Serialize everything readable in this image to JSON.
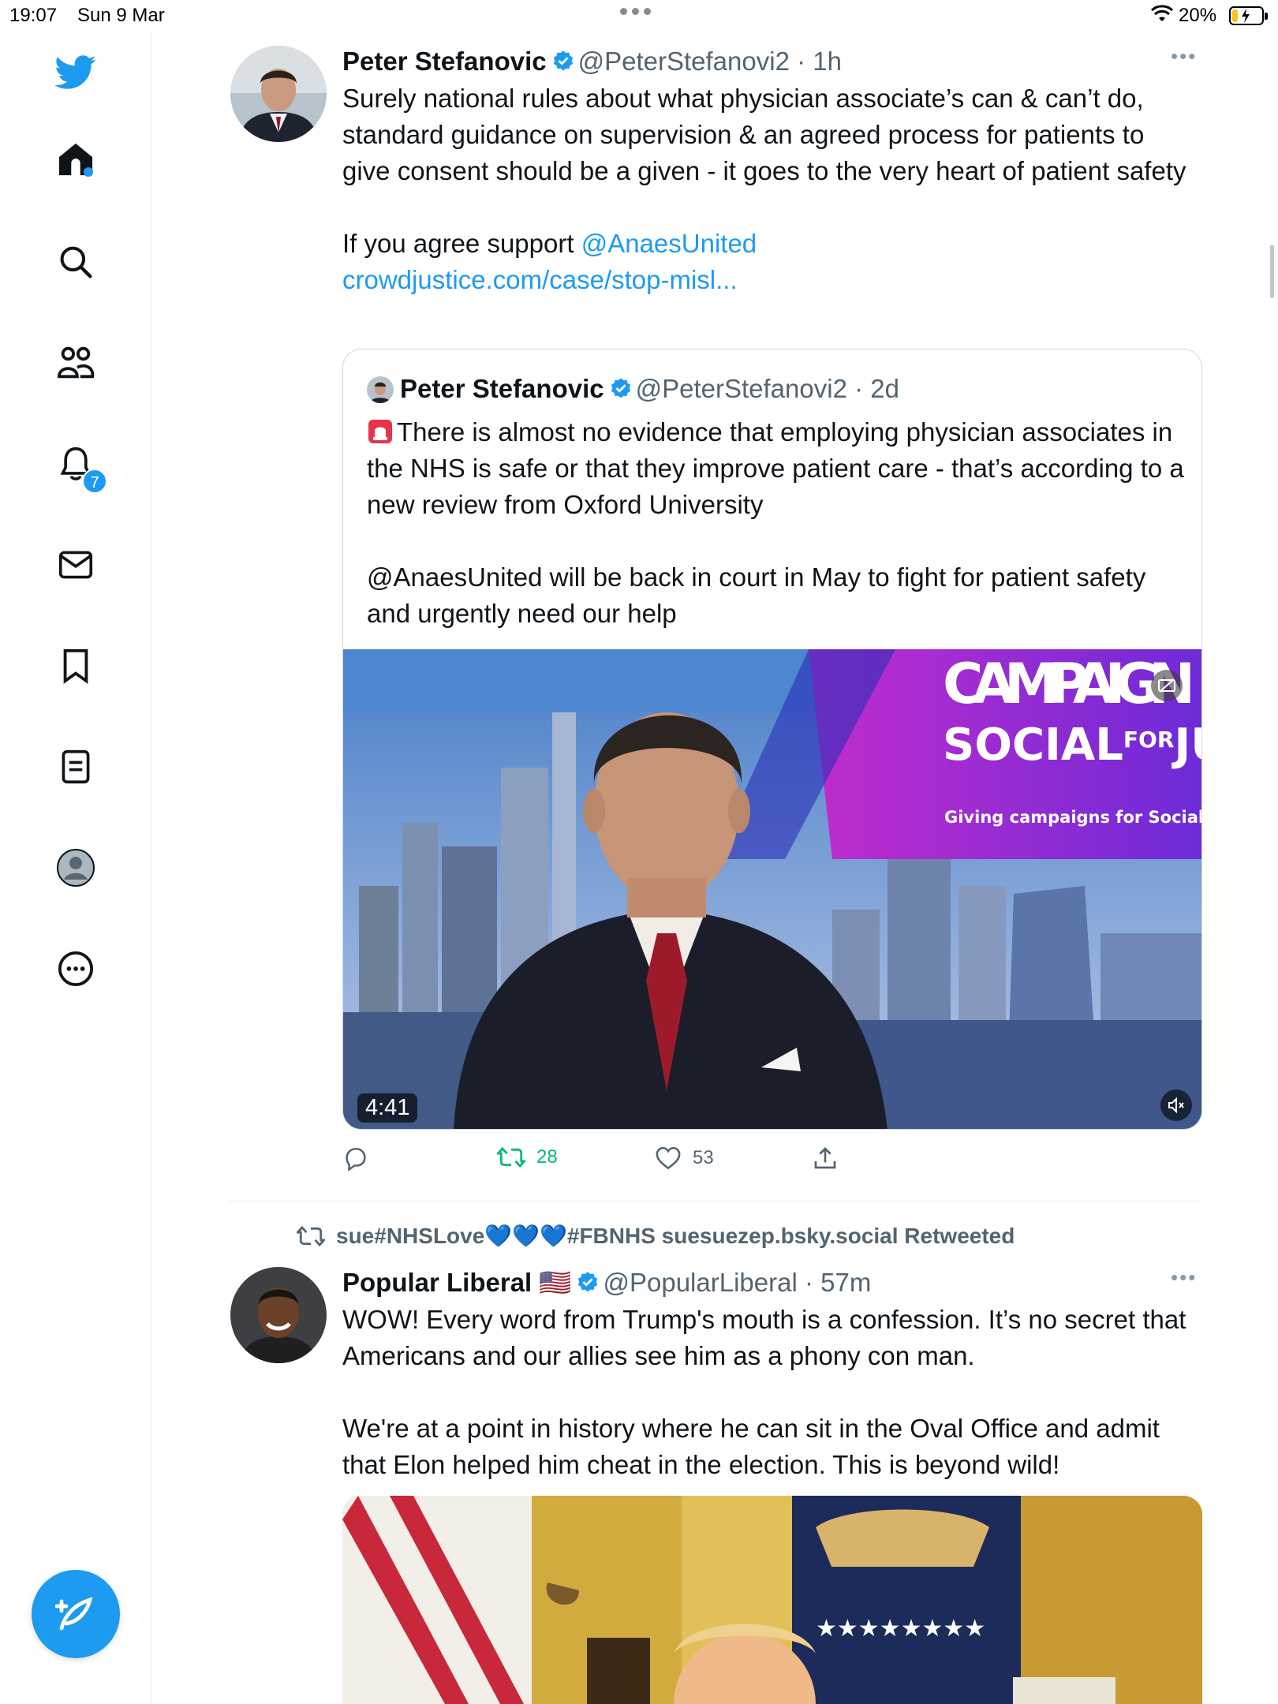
{
  "status_bar": {
    "time": "19:07",
    "date": "Sun 9 Mar",
    "battery": "20%",
    "battery_fraction": 0.2
  },
  "sidebar": {
    "items": [
      {
        "icon": "twitter-bird-icon"
      },
      {
        "icon": "home-icon"
      },
      {
        "icon": "search-icon"
      },
      {
        "icon": "communities-icon"
      },
      {
        "icon": "notifications-icon"
      },
      {
        "icon": "messages-icon"
      },
      {
        "icon": "bookmarks-icon"
      },
      {
        "icon": "lists-icon"
      },
      {
        "icon": "profile-icon"
      },
      {
        "icon": "more-icon"
      }
    ],
    "notification_count": "7",
    "compose_icon": "compose-tweet-icon"
  },
  "accent_color": "#1d9bf0",
  "tweets": [
    {
      "name": "Peter Stefanovic",
      "handle": "@PeterStefanovi2",
      "time": "· 1h",
      "text": "Surely national rules about what physician associate’s can & can’t do, standard guidance on supervision & an agreed process for patients to give consent should be a given - it goes to the very heart of patient safety",
      "text2_prefix": "If you agree support ",
      "mention": "@AnaesUnited",
      "url": "crowdjustice.com/case/stop-misl...",
      "quote": {
        "name": "Peter Stefanovic",
        "handle": "@PeterStefanovi2",
        "time": "· 2d",
        "text": "There is almost no evidence that employing physician associates in the NHS is safe or that they improve patient care - that’s according to a new review from Oxford University",
        "text2": "@AnaesUnited will be back in court in May to fight for patient safety and urgently need our help",
        "video": {
          "banner_line1": "CAMPAIGN",
          "banner_line2a": "SOCIAL",
          "banner_line2b": "FOR",
          "banner_line2c": "JUSTICE",
          "banner_tagline": "Giving campaigns for Social Justice a voice",
          "duration": "4:41"
        }
      },
      "actions": {
        "reply_count": "",
        "retweet_count": "28",
        "like_count": "53"
      }
    },
    {
      "retweeted_by": "sue#NHSLove💙💙💙#FBNHS suesuezep.bsky.social Retweeted",
      "name": "Popular Liberal",
      "flag": "🇺🇸",
      "handle": "@PopularLiberal",
      "time": "· 57m",
      "text": "WOW! Every word from Trump's mouth is a confession. It’s no secret that Americans and our allies see him as a phony con man.",
      "text2": "We're at a point in history where he can sit in the Oval Office and admit that Elon helped him cheat in the election. This is beyond wild!"
    }
  ]
}
